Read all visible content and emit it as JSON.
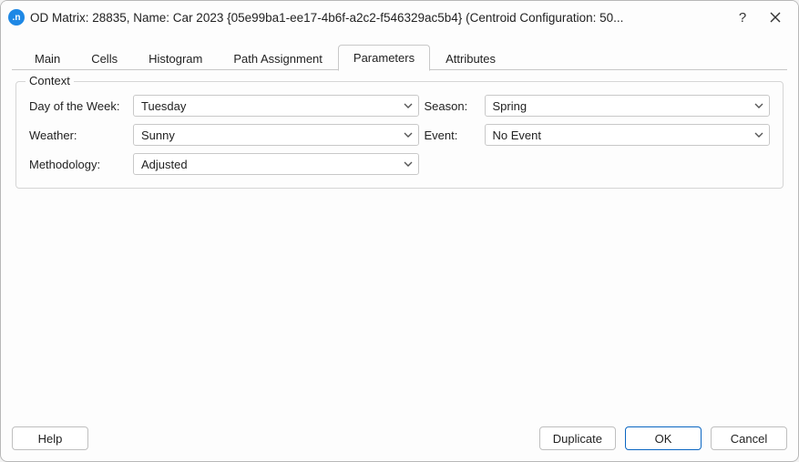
{
  "titlebar": {
    "app_icon_glyph": ".n",
    "title": "OD Matrix: 28835, Name: Car 2023  {05e99ba1-ee17-4b6f-a2c2-f546329ac5b4} (Centroid Configuration: 50...",
    "help_glyph": "?",
    "close_glyph": "×"
  },
  "tabs": [
    {
      "id": "main",
      "label": "Main",
      "active": false
    },
    {
      "id": "cells",
      "label": "Cells",
      "active": false
    },
    {
      "id": "histogram",
      "label": "Histogram",
      "active": false
    },
    {
      "id": "path",
      "label": "Path Assignment",
      "active": false
    },
    {
      "id": "parameters",
      "label": "Parameters",
      "active": true
    },
    {
      "id": "attributes",
      "label": "Attributes",
      "active": false
    }
  ],
  "fieldset": {
    "legend": "Context",
    "fields": {
      "day_of_week": {
        "label": "Day of the Week:",
        "value": "Tuesday"
      },
      "season": {
        "label": "Season:",
        "value": "Spring"
      },
      "weather": {
        "label": "Weather:",
        "value": "Sunny"
      },
      "event": {
        "label": "Event:",
        "value": "No Event"
      },
      "methodology": {
        "label": "Methodology:",
        "value": "Adjusted"
      }
    }
  },
  "footer": {
    "help": "Help",
    "duplicate": "Duplicate",
    "ok": "OK",
    "cancel": "Cancel"
  }
}
